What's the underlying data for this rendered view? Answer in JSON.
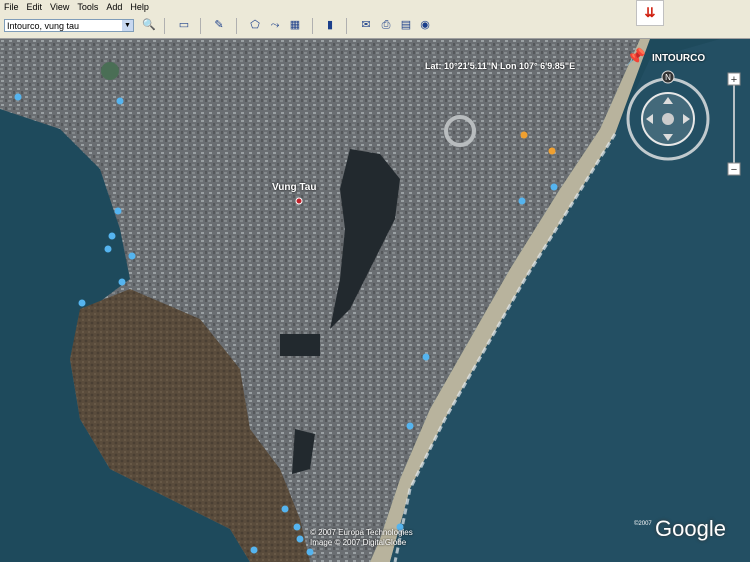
{
  "menu": [
    "File",
    "Edit",
    "View",
    "Tools",
    "Add",
    "Help"
  ],
  "search": {
    "value": "Intourco, vung tau"
  },
  "map": {
    "coords": "Lat: 10°21'5.11\"N  Lon 107° 6'9.85\"E",
    "placemark_label": "INTOURCO",
    "city_label": "Vung Tau",
    "copyright_line1": "© 2007 Europa Technologies",
    "copyright_line2": "Image © 2007 DigitalGlobe",
    "logo": "Google",
    "logo_year": "©2007",
    "compass_n": "N"
  },
  "colors": {
    "sea": "#1e4a5c",
    "land": "#6c7073",
    "beach": "#c9bfa4",
    "hill": "#5a4c3c"
  }
}
